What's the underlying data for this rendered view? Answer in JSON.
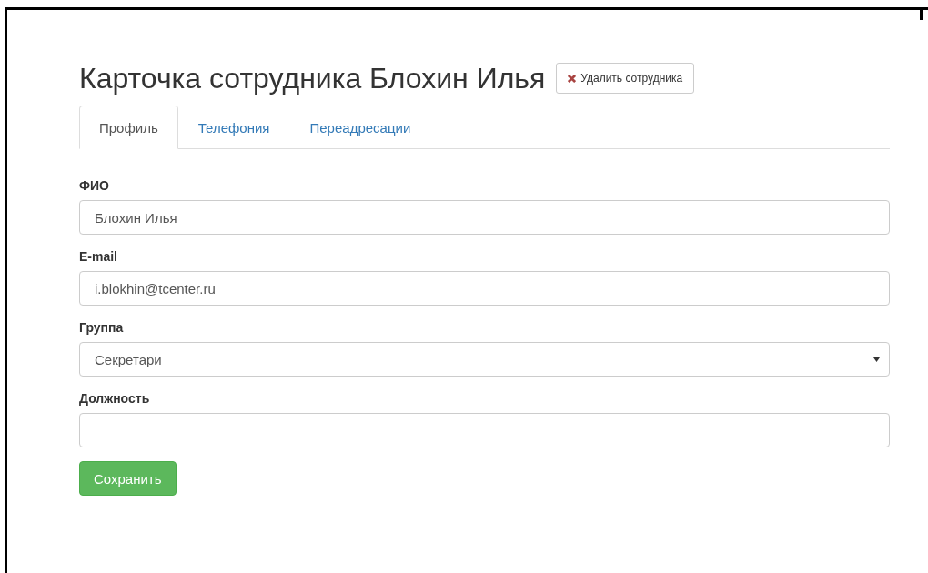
{
  "header": {
    "title": "Карточка сотрудника Блохин Илья",
    "delete_button": "Удалить сотрудника"
  },
  "tabs": [
    {
      "label": "Профиль",
      "selected": true
    },
    {
      "label": "Телефония",
      "selected": false
    },
    {
      "label": "Переадресации",
      "selected": false
    }
  ],
  "fields": [
    {
      "kind": "text",
      "label": "ФИО",
      "value": "Блохин Илья"
    },
    {
      "kind": "text",
      "label": "E-mail",
      "value": "i.blokhin@tcenter.ru"
    },
    {
      "kind": "select",
      "label": "Группа",
      "value": "Секретари"
    },
    {
      "kind": "text",
      "label": "Должность"
    }
  ],
  "save_button": "Сохранить"
}
